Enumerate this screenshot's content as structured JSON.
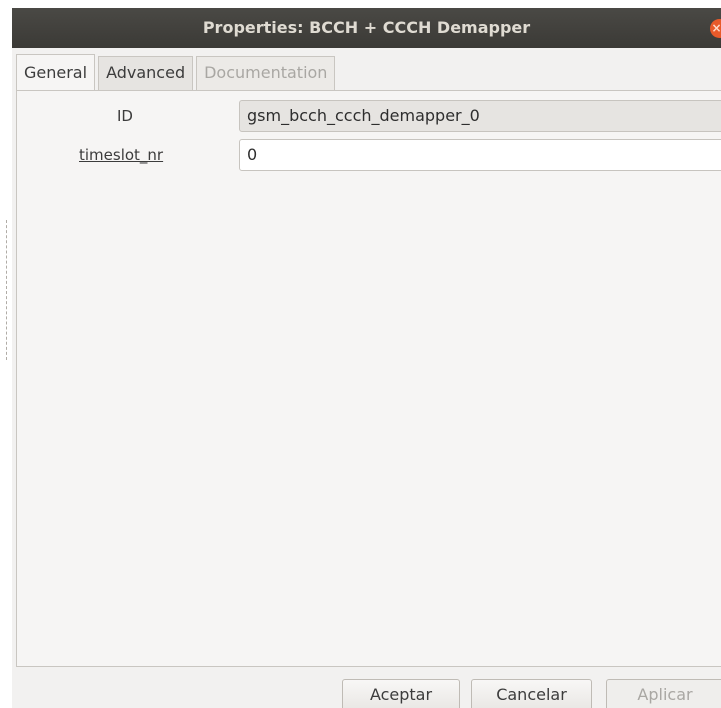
{
  "window": {
    "title": "Properties: BCCH + CCCH Demapper",
    "close_icon": "×"
  },
  "tabs": [
    {
      "label": "General",
      "state": "active"
    },
    {
      "label": "Advanced",
      "state": "normal"
    },
    {
      "label": "Documentation",
      "state": "disabled"
    }
  ],
  "params": {
    "id": {
      "label": "ID",
      "value": "gsm_bcch_ccch_demapper_0"
    },
    "timeslot_nr": {
      "label": "timeslot_nr",
      "value": "0"
    }
  },
  "buttons": {
    "ok": "Aceptar",
    "cancel": "Cancelar",
    "apply": "Aplicar"
  }
}
